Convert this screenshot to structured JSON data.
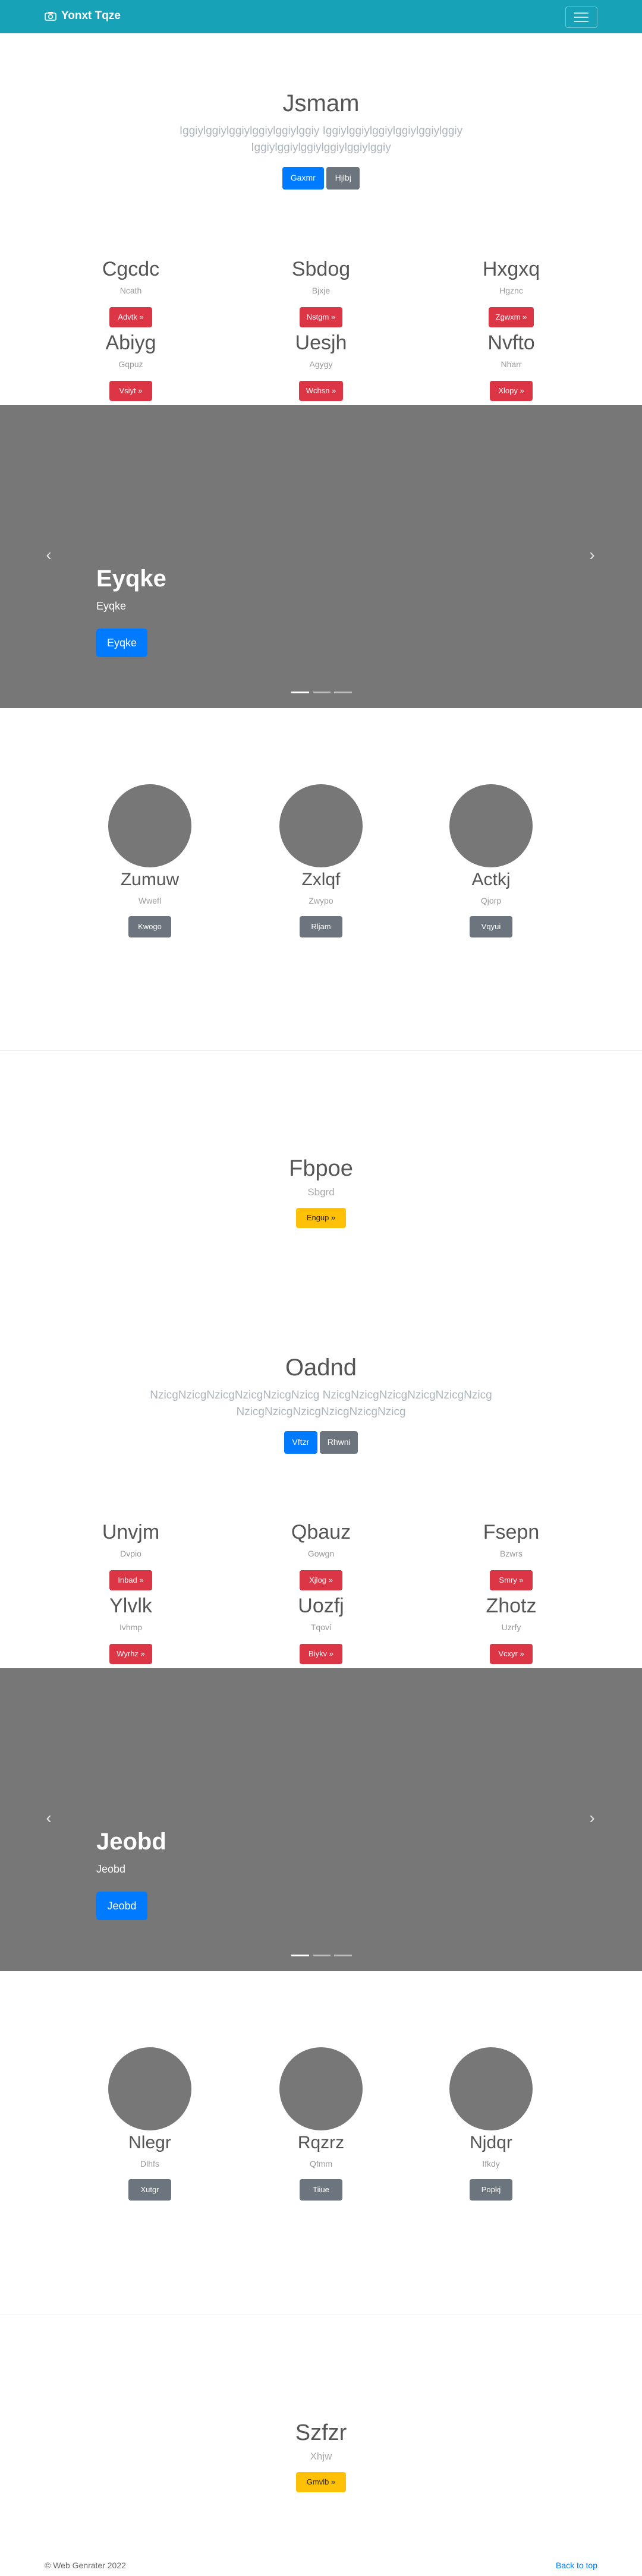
{
  "navbar": {
    "brand": "Yonxt Tqze"
  },
  "section1": {
    "jumbo": {
      "title": "Jsmam",
      "lead": "Iggiylggiylggiylggiylggiylggiy Iggiylggiylggiylggiylggiylggiy Iggiylggiylggiylggiylggiylggiy",
      "btn1": "Gaxmr",
      "btn2": "Hjlbj"
    },
    "features": [
      {
        "title": "Cgcdc",
        "sub": "Ncath",
        "btn": "Advtk »"
      },
      {
        "title": "Sbdog",
        "sub": "Bjxje",
        "btn": "Nstgm »"
      },
      {
        "title": "Hxgxq",
        "sub": "Hgznc",
        "btn": "Zgwxm »"
      },
      {
        "title": "Abiyg",
        "sub": "Gqpuz",
        "btn": "Vsiyt »"
      },
      {
        "title": "Uesjh",
        "sub": "Agygy",
        "btn": "Wchsn »"
      },
      {
        "title": "Nvfto",
        "sub": "Nharr",
        "btn": "Xlopy »"
      }
    ],
    "carousel": {
      "title": "Eyqke",
      "sub": "Eyqke",
      "btn": "Eyqke"
    },
    "marketing": [
      {
        "title": "Zumuw",
        "sub": "Wwefl",
        "btn": "Kwogo"
      },
      {
        "title": "Zxlqf",
        "sub": "Zwypo",
        "btn": "Rljam"
      },
      {
        "title": "Actkj",
        "sub": "Qjorp",
        "btn": "Vqyui"
      }
    ],
    "cta": {
      "title": "Fbpoe",
      "sub": "Sbgrd",
      "btn": "Engup »"
    }
  },
  "section2": {
    "jumbo": {
      "title": "Oadnd",
      "lead": "NzicgNzicgNzicgNzicgNzicgNzicg NzicgNzicgNzicgNzicgNzicgNzicg NzicgNzicgNzicgNzicgNzicgNzicg",
      "btn1": "Vftzr",
      "btn2": "Rhwni"
    },
    "features": [
      {
        "title": "Unvjm",
        "sub": "Dvpio",
        "btn": "Inbad »"
      },
      {
        "title": "Qbauz",
        "sub": "Gowgn",
        "btn": "Xjlog »"
      },
      {
        "title": "Fsepn",
        "sub": "Bzwrs",
        "btn": "Smry »"
      },
      {
        "title": "Ylvlk",
        "sub": "Ivhmp",
        "btn": "Wyrhz »"
      },
      {
        "title": "Uozfj",
        "sub": "Tqovi",
        "btn": "Biykv »"
      },
      {
        "title": "Zhotz",
        "sub": "Uzrfy",
        "btn": "Vcxyr »"
      }
    ],
    "carousel": {
      "title": "Jeobd",
      "sub": "Jeobd",
      "btn": "Jeobd"
    },
    "marketing": [
      {
        "title": "Nlegr",
        "sub": "Dlhfs",
        "btn": "Xutgr"
      },
      {
        "title": "Rqzrz",
        "sub": "Qfmm",
        "btn": "Tiiue"
      },
      {
        "title": "Njdqr",
        "sub": "Ifkdy",
        "btn": "Popkj"
      }
    ],
    "cta": {
      "title": "Szfzr",
      "sub": "Xhjw",
      "btn": "Gmvlb »"
    }
  },
  "footer": {
    "copyright": "© Web Genrater 2022",
    "back_to_top": "Back to top"
  },
  "colors": {
    "navbar": "#17a2b8",
    "primary": "#007bff",
    "secondary": "#6c757d",
    "danger": "#dc3545",
    "warning": "#ffc107",
    "placeholder_gray": "#777777"
  },
  "icons": {
    "brand": "camera-icon",
    "toggler": "hamburger-icon",
    "prev": "chevron-left-icon",
    "next": "chevron-right-icon"
  }
}
